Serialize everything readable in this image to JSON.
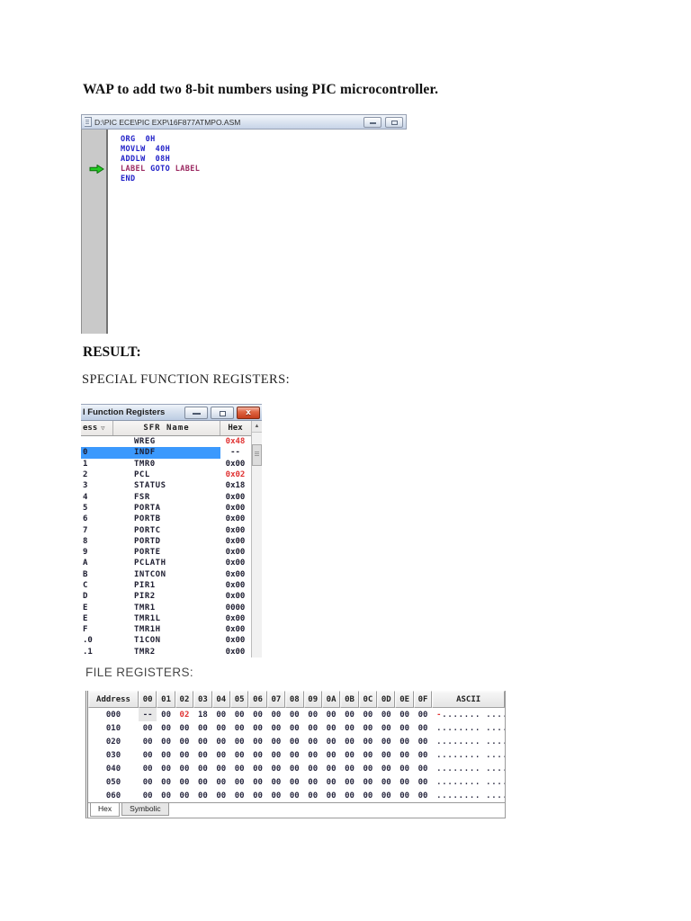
{
  "document": {
    "title": "WAP to add two 8-bit numbers using PIC microcontroller.",
    "result_heading": "RESULT:",
    "sfr_heading": "SPECIAL FUNCTION REGISTERS:",
    "file_registers_heading": "FILE REGISTERS:"
  },
  "colors": {
    "code_blue": "#2121c8",
    "code_maroon": "#9c2a62",
    "changed_red": "#e03232",
    "selection_blue": "#3b99fd"
  },
  "editor_window": {
    "title": "D:\\PIC ECE\\PIC EXP\\16F877ATMPO.ASM",
    "code_lines": [
      {
        "tokens": [
          {
            "text": "ORG  0H",
            "color": "blue"
          }
        ]
      },
      {
        "tokens": [
          {
            "text": "MOVLW  40H",
            "color": "blue"
          }
        ]
      },
      {
        "tokens": [
          {
            "text": "ADDLW  08H",
            "color": "blue"
          }
        ]
      },
      {
        "tokens": [
          {
            "text": "LABEL ",
            "color": "maroon"
          },
          {
            "text": "GOTO ",
            "color": "blue"
          },
          {
            "text": "LABEL",
            "color": "maroon"
          }
        ],
        "current_line": true
      },
      {
        "tokens": [
          {
            "text": "END",
            "color": "blue"
          }
        ]
      }
    ]
  },
  "sfr_window": {
    "title": "l Function Registers",
    "columns": {
      "address_label": "ess",
      "sort_indicator": "▽",
      "name_label": "SFR Name",
      "hex_label": "Hex"
    },
    "rows": [
      {
        "addr": "",
        "name": "WREG",
        "hex": "0x48",
        "red": true
      },
      {
        "addr": "0",
        "name": "INDF",
        "hex": "--",
        "selected": true
      },
      {
        "addr": "1",
        "name": "TMR0",
        "hex": "0x00"
      },
      {
        "addr": "2",
        "name": "PCL",
        "hex": "0x02",
        "red": true
      },
      {
        "addr": "3",
        "name": "STATUS",
        "hex": "0x18"
      },
      {
        "addr": "4",
        "name": "FSR",
        "hex": "0x00"
      },
      {
        "addr": "5",
        "name": "PORTA",
        "hex": "0x00"
      },
      {
        "addr": "6",
        "name": "PORTB",
        "hex": "0x00"
      },
      {
        "addr": "7",
        "name": "PORTC",
        "hex": "0x00"
      },
      {
        "addr": "8",
        "name": "PORTD",
        "hex": "0x00"
      },
      {
        "addr": "9",
        "name": "PORTE",
        "hex": "0x00"
      },
      {
        "addr": "A",
        "name": "PCLATH",
        "hex": "0x00"
      },
      {
        "addr": "B",
        "name": "INTCON",
        "hex": "0x00"
      },
      {
        "addr": "C",
        "name": "PIR1",
        "hex": "0x00"
      },
      {
        "addr": "D",
        "name": "PIR2",
        "hex": "0x00"
      },
      {
        "addr": "E",
        "name": "TMR1",
        "hex": "0000"
      },
      {
        "addr": "E",
        "name": "TMR1L",
        "hex": "0x00"
      },
      {
        "addr": "F",
        "name": "TMR1H",
        "hex": "0x00"
      },
      {
        "addr": ".0",
        "name": "T1CON",
        "hex": "0x00"
      },
      {
        "addr": ".1",
        "name": "TMR2",
        "hex": "0x00"
      }
    ]
  },
  "file_registers_window": {
    "headers": [
      "Address",
      "00",
      "01",
      "02",
      "03",
      "04",
      "05",
      "06",
      "07",
      "08",
      "09",
      "0A",
      "0B",
      "0C",
      "0D",
      "0E",
      "0F",
      "ASCII"
    ],
    "rows": [
      {
        "address": "000",
        "values": [
          "--",
          "00",
          "02",
          "18",
          "00",
          "00",
          "00",
          "00",
          "00",
          "00",
          "00",
          "00",
          "00",
          "00",
          "00",
          "00"
        ],
        "red_indices": [
          2
        ],
        "dim_indices": [
          0
        ],
        "ascii_lead": "-",
        "ascii_lead_red": true,
        "ascii_rest": "....... ........"
      },
      {
        "address": "010",
        "values": [
          "00",
          "00",
          "00",
          "00",
          "00",
          "00",
          "00",
          "00",
          "00",
          "00",
          "00",
          "00",
          "00",
          "00",
          "00",
          "00"
        ],
        "red_indices": [],
        "dim_indices": [],
        "ascii_lead": "",
        "ascii_lead_red": false,
        "ascii_rest": "........ ........"
      },
      {
        "address": "020",
        "values": [
          "00",
          "00",
          "00",
          "00",
          "00",
          "00",
          "00",
          "00",
          "00",
          "00",
          "00",
          "00",
          "00",
          "00",
          "00",
          "00"
        ],
        "red_indices": [],
        "dim_indices": [],
        "ascii_lead": "",
        "ascii_lead_red": false,
        "ascii_rest": "........ ........"
      },
      {
        "address": "030",
        "values": [
          "00",
          "00",
          "00",
          "00",
          "00",
          "00",
          "00",
          "00",
          "00",
          "00",
          "00",
          "00",
          "00",
          "00",
          "00",
          "00"
        ],
        "red_indices": [],
        "dim_indices": [],
        "ascii_lead": "",
        "ascii_lead_red": false,
        "ascii_rest": "........ ........"
      },
      {
        "address": "040",
        "values": [
          "00",
          "00",
          "00",
          "00",
          "00",
          "00",
          "00",
          "00",
          "00",
          "00",
          "00",
          "00",
          "00",
          "00",
          "00",
          "00"
        ],
        "red_indices": [],
        "dim_indices": [],
        "ascii_lead": "",
        "ascii_lead_red": false,
        "ascii_rest": "........ ........"
      },
      {
        "address": "050",
        "values": [
          "00",
          "00",
          "00",
          "00",
          "00",
          "00",
          "00",
          "00",
          "00",
          "00",
          "00",
          "00",
          "00",
          "00",
          "00",
          "00"
        ],
        "red_indices": [],
        "dim_indices": [],
        "ascii_lead": "",
        "ascii_lead_red": false,
        "ascii_rest": "........ ........"
      },
      {
        "address": "060",
        "values": [
          "00",
          "00",
          "00",
          "00",
          "00",
          "00",
          "00",
          "00",
          "00",
          "00",
          "00",
          "00",
          "00",
          "00",
          "00",
          "00"
        ],
        "red_indices": [],
        "dim_indices": [],
        "ascii_lead": "",
        "ascii_lead_red": false,
        "ascii_rest": "........ ........"
      }
    ],
    "tabs": [
      {
        "label": "Hex",
        "active": true
      },
      {
        "label": "Symbolic",
        "active": false
      }
    ]
  }
}
